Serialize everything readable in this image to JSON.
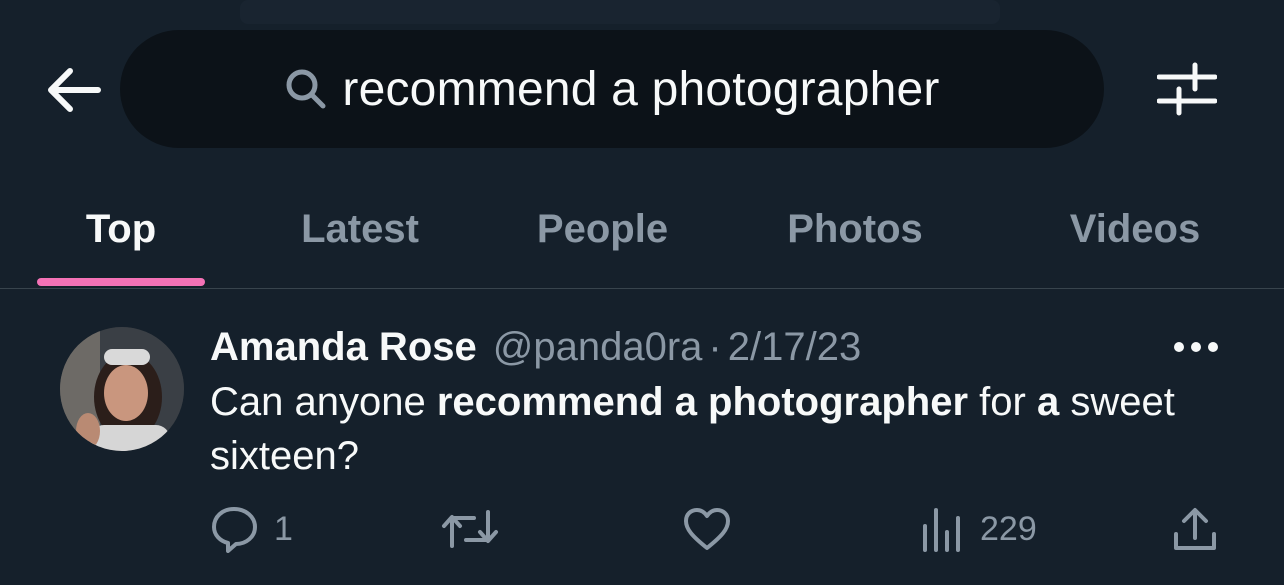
{
  "search": {
    "query": "recommend a photographer"
  },
  "tabs": [
    {
      "label": "Top",
      "active": true
    },
    {
      "label": "Latest",
      "active": false
    },
    {
      "label": "People",
      "active": false
    },
    {
      "label": "Photos",
      "active": false
    },
    {
      "label": "Videos",
      "active": false
    }
  ],
  "colors": {
    "background": "#15202b",
    "search_background": "#0c1218",
    "muted_text": "#8b98a5",
    "primary_text": "#f7f9f9",
    "tab_indicator": "#f472b6"
  },
  "tweet": {
    "display_name": "Amanda Rose",
    "handle": "@panda0ra",
    "separator": "·",
    "date": "2/17/23",
    "text_segments": [
      {
        "text": "Can anyone ",
        "bold": false
      },
      {
        "text": "recommend a photographer",
        "bold": true
      },
      {
        "text": " for ",
        "bold": false
      },
      {
        "text": "a",
        "bold": true
      },
      {
        "text": " sweet sixteen?",
        "bold": false
      }
    ],
    "stats": {
      "replies": "1",
      "reposts": "",
      "likes": "",
      "views": "229"
    }
  },
  "icons": {
    "back": "arrow-left-icon",
    "search": "search-icon",
    "filter": "filter-sliders-icon",
    "more": "more-horizontal-icon",
    "reply": "reply-bubble-icon",
    "repost": "repost-icon",
    "like": "heart-icon",
    "views": "analytics-bars-icon",
    "share": "share-upload-icon"
  }
}
